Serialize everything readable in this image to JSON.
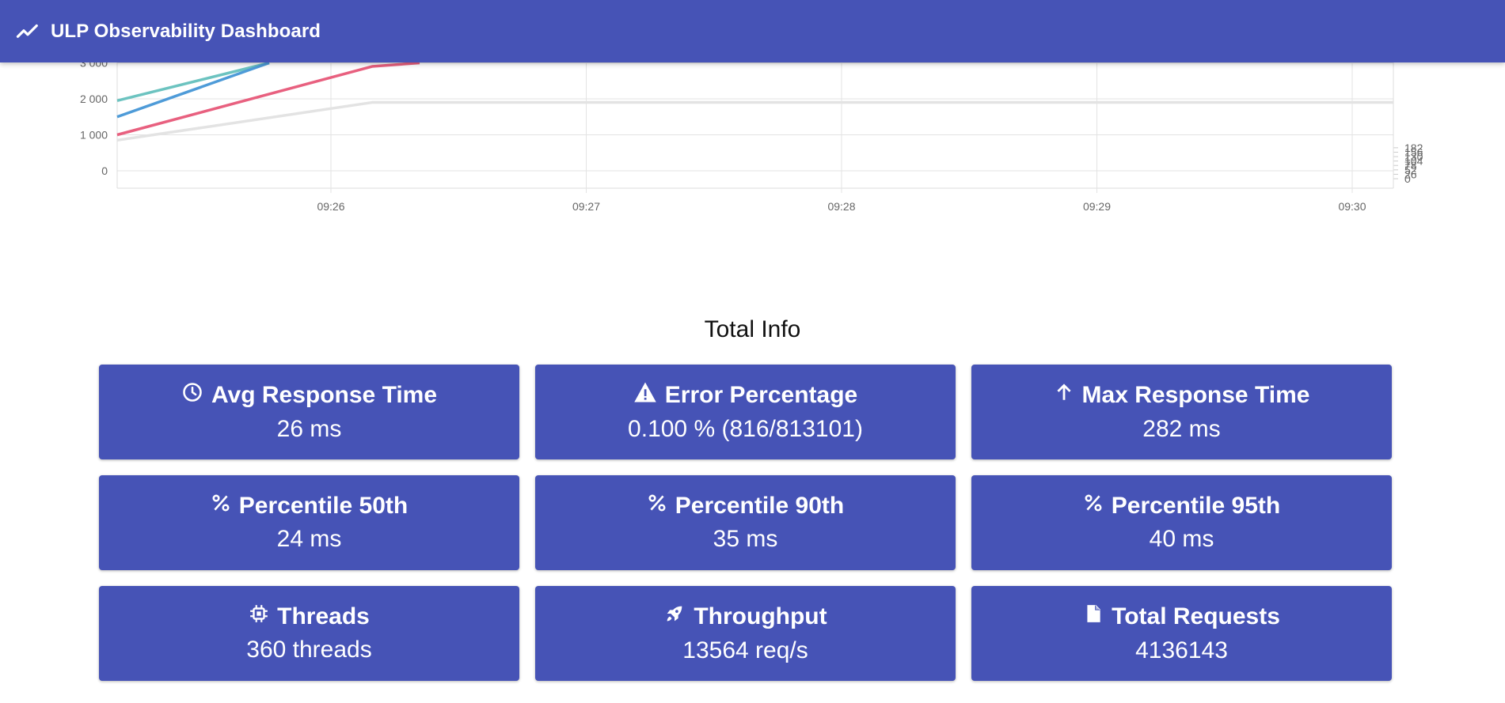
{
  "app": {
    "title": "ULP Observability Dashboard",
    "icon": "trending-up-icon"
  },
  "chart_data": {
    "type": "line",
    "x_ticks": [
      "09:26",
      "09:27",
      "09:28",
      "09:29",
      "09:30"
    ],
    "y_left_ticks": [
      "0",
      "1 000",
      "2 000",
      "3 000"
    ],
    "y_right_ticks": [
      "0",
      "26",
      "52",
      "78",
      "104",
      "130",
      "156",
      "182"
    ],
    "series": [
      {
        "color": "#6cc3c0",
        "values": [
          1950,
          3000
        ]
      },
      {
        "color": "#4e9bd8",
        "values": [
          1500,
          3000
        ]
      },
      {
        "color": "#e8607f",
        "values": [
          1000,
          2900,
          3000
        ]
      },
      {
        "color": "#e3e3e3",
        "values": [
          850,
          1900,
          1900,
          1900,
          1900,
          1900,
          1900
        ]
      }
    ]
  },
  "summary": {
    "title": "Total Info",
    "cards": [
      {
        "icon": "clock-icon",
        "label": "Avg Response Time",
        "value": "26 ms"
      },
      {
        "icon": "warning-icon",
        "label": "Error Percentage",
        "value": "0.100 % (816/813101)"
      },
      {
        "icon": "arrow-up-icon",
        "label": "Max Response Time",
        "value": "282 ms"
      },
      {
        "icon": "percent-icon",
        "label": "Percentile 50th",
        "value": "24 ms"
      },
      {
        "icon": "percent-icon",
        "label": "Percentile 90th",
        "value": "35 ms"
      },
      {
        "icon": "percent-icon",
        "label": "Percentile 95th",
        "value": "40 ms"
      },
      {
        "icon": "chip-icon",
        "label": "Threads",
        "value": "360 threads"
      },
      {
        "icon": "rocket-icon",
        "label": "Throughput",
        "value": "13564 req/s"
      },
      {
        "icon": "file-icon",
        "label": "Total Requests",
        "value": "4136143"
      }
    ]
  }
}
